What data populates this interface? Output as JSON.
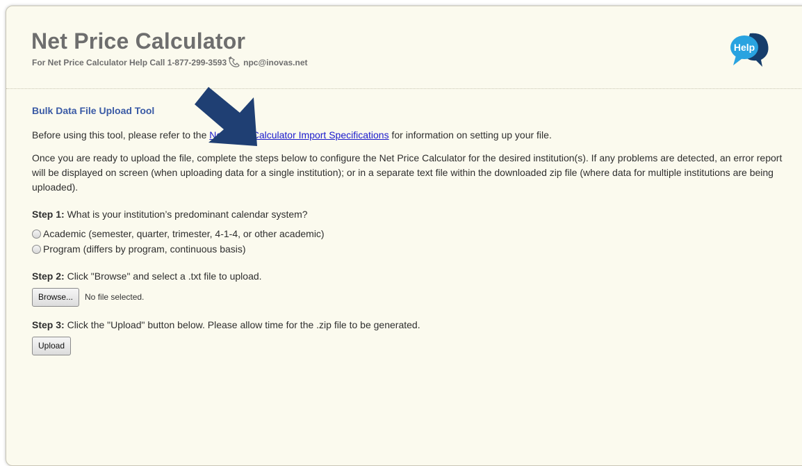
{
  "header": {
    "title": "Net Price Calculator",
    "subtitle_prefix": "For Net Price Calculator Help Call 1-877-299-3593",
    "email": "npc@inovas.net",
    "help_label": "Help"
  },
  "tool": {
    "title": "Bulk Data File Upload Tool",
    "intro_before": "Before using this tool, please refer to the ",
    "spec_link": "Net Price Calculator Import Specifications",
    "intro_after": " for information on setting up your file.",
    "instructions": "Once you are ready to upload the file, complete the steps below to configure the Net Price Calculator for the desired institution(s). If any problems are detected, an error report will be displayed on screen (when uploading data for a single institution); or in a separate text file within the downloaded zip file (where data for multiple institutions are being uploaded)."
  },
  "step1": {
    "label": "Step 1:",
    "text": " What is your institution’s predominant calendar system?",
    "options": [
      "Academic (semester, quarter, trimester, 4-1-4, or other academic)",
      "Program (differs by program, continuous basis)"
    ]
  },
  "step2": {
    "label": "Step 2:",
    "text": " Click \"Browse\" and select a .txt file to upload.",
    "browse_label": "Browse...",
    "file_status": "No file selected."
  },
  "step3": {
    "label": "Step 3:",
    "text": " Click the \"Upload\" button below. Please allow time for the .zip file to be generated.",
    "upload_label": "Upload"
  },
  "colors": {
    "page_bg": "#fbfaee",
    "tool_title": "#3a5aa5",
    "link": "#1a1acc",
    "arrow": "#1f3f73",
    "help_bubble": "#29a3e0"
  }
}
